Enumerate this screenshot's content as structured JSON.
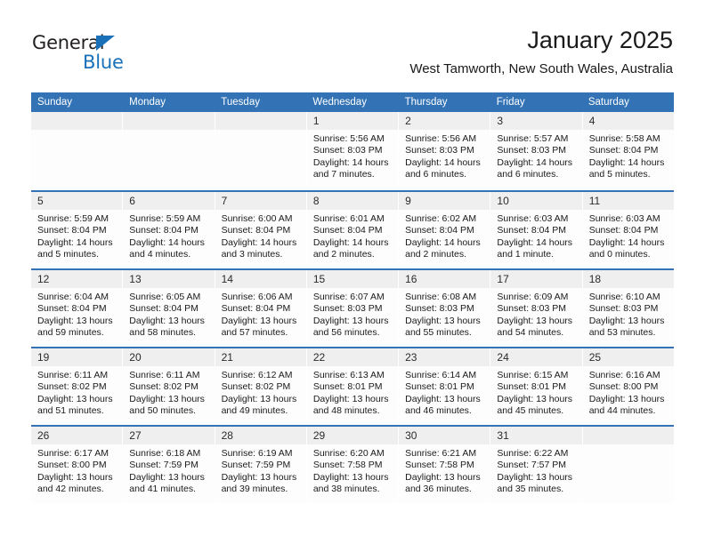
{
  "brand": {
    "name_top": "General",
    "name_bottom": "Blue",
    "accent_color": "#1a71b8"
  },
  "header": {
    "title": "January 2025",
    "subtitle": "West Tamworth, New South Wales, Australia"
  },
  "calendar": {
    "header_bg": "#3373b5",
    "daynum_bg": "#efefef",
    "weekdays": [
      "Sunday",
      "Monday",
      "Tuesday",
      "Wednesday",
      "Thursday",
      "Friday",
      "Saturday"
    ],
    "weeks": [
      [
        {
          "day": "",
          "lines": []
        },
        {
          "day": "",
          "lines": []
        },
        {
          "day": "",
          "lines": []
        },
        {
          "day": "1",
          "lines": [
            "Sunrise: 5:56 AM",
            "Sunset: 8:03 PM",
            "Daylight: 14 hours",
            "and 7 minutes."
          ]
        },
        {
          "day": "2",
          "lines": [
            "Sunrise: 5:56 AM",
            "Sunset: 8:03 PM",
            "Daylight: 14 hours",
            "and 6 minutes."
          ]
        },
        {
          "day": "3",
          "lines": [
            "Sunrise: 5:57 AM",
            "Sunset: 8:03 PM",
            "Daylight: 14 hours",
            "and 6 minutes."
          ]
        },
        {
          "day": "4",
          "lines": [
            "Sunrise: 5:58 AM",
            "Sunset: 8:04 PM",
            "Daylight: 14 hours",
            "and 5 minutes."
          ]
        }
      ],
      [
        {
          "day": "5",
          "lines": [
            "Sunrise: 5:59 AM",
            "Sunset: 8:04 PM",
            "Daylight: 14 hours",
            "and 5 minutes."
          ]
        },
        {
          "day": "6",
          "lines": [
            "Sunrise: 5:59 AM",
            "Sunset: 8:04 PM",
            "Daylight: 14 hours",
            "and 4 minutes."
          ]
        },
        {
          "day": "7",
          "lines": [
            "Sunrise: 6:00 AM",
            "Sunset: 8:04 PM",
            "Daylight: 14 hours",
            "and 3 minutes."
          ]
        },
        {
          "day": "8",
          "lines": [
            "Sunrise: 6:01 AM",
            "Sunset: 8:04 PM",
            "Daylight: 14 hours",
            "and 2 minutes."
          ]
        },
        {
          "day": "9",
          "lines": [
            "Sunrise: 6:02 AM",
            "Sunset: 8:04 PM",
            "Daylight: 14 hours",
            "and 2 minutes."
          ]
        },
        {
          "day": "10",
          "lines": [
            "Sunrise: 6:03 AM",
            "Sunset: 8:04 PM",
            "Daylight: 14 hours",
            "and 1 minute."
          ]
        },
        {
          "day": "11",
          "lines": [
            "Sunrise: 6:03 AM",
            "Sunset: 8:04 PM",
            "Daylight: 14 hours",
            "and 0 minutes."
          ]
        }
      ],
      [
        {
          "day": "12",
          "lines": [
            "Sunrise: 6:04 AM",
            "Sunset: 8:04 PM",
            "Daylight: 13 hours",
            "and 59 minutes."
          ]
        },
        {
          "day": "13",
          "lines": [
            "Sunrise: 6:05 AM",
            "Sunset: 8:04 PM",
            "Daylight: 13 hours",
            "and 58 minutes."
          ]
        },
        {
          "day": "14",
          "lines": [
            "Sunrise: 6:06 AM",
            "Sunset: 8:04 PM",
            "Daylight: 13 hours",
            "and 57 minutes."
          ]
        },
        {
          "day": "15",
          "lines": [
            "Sunrise: 6:07 AM",
            "Sunset: 8:03 PM",
            "Daylight: 13 hours",
            "and 56 minutes."
          ]
        },
        {
          "day": "16",
          "lines": [
            "Sunrise: 6:08 AM",
            "Sunset: 8:03 PM",
            "Daylight: 13 hours",
            "and 55 minutes."
          ]
        },
        {
          "day": "17",
          "lines": [
            "Sunrise: 6:09 AM",
            "Sunset: 8:03 PM",
            "Daylight: 13 hours",
            "and 54 minutes."
          ]
        },
        {
          "day": "18",
          "lines": [
            "Sunrise: 6:10 AM",
            "Sunset: 8:03 PM",
            "Daylight: 13 hours",
            "and 53 minutes."
          ]
        }
      ],
      [
        {
          "day": "19",
          "lines": [
            "Sunrise: 6:11 AM",
            "Sunset: 8:02 PM",
            "Daylight: 13 hours",
            "and 51 minutes."
          ]
        },
        {
          "day": "20",
          "lines": [
            "Sunrise: 6:11 AM",
            "Sunset: 8:02 PM",
            "Daylight: 13 hours",
            "and 50 minutes."
          ]
        },
        {
          "day": "21",
          "lines": [
            "Sunrise: 6:12 AM",
            "Sunset: 8:02 PM",
            "Daylight: 13 hours",
            "and 49 minutes."
          ]
        },
        {
          "day": "22",
          "lines": [
            "Sunrise: 6:13 AM",
            "Sunset: 8:01 PM",
            "Daylight: 13 hours",
            "and 48 minutes."
          ]
        },
        {
          "day": "23",
          "lines": [
            "Sunrise: 6:14 AM",
            "Sunset: 8:01 PM",
            "Daylight: 13 hours",
            "and 46 minutes."
          ]
        },
        {
          "day": "24",
          "lines": [
            "Sunrise: 6:15 AM",
            "Sunset: 8:01 PM",
            "Daylight: 13 hours",
            "and 45 minutes."
          ]
        },
        {
          "day": "25",
          "lines": [
            "Sunrise: 6:16 AM",
            "Sunset: 8:00 PM",
            "Daylight: 13 hours",
            "and 44 minutes."
          ]
        }
      ],
      [
        {
          "day": "26",
          "lines": [
            "Sunrise: 6:17 AM",
            "Sunset: 8:00 PM",
            "Daylight: 13 hours",
            "and 42 minutes."
          ]
        },
        {
          "day": "27",
          "lines": [
            "Sunrise: 6:18 AM",
            "Sunset: 7:59 PM",
            "Daylight: 13 hours",
            "and 41 minutes."
          ]
        },
        {
          "day": "28",
          "lines": [
            "Sunrise: 6:19 AM",
            "Sunset: 7:59 PM",
            "Daylight: 13 hours",
            "and 39 minutes."
          ]
        },
        {
          "day": "29",
          "lines": [
            "Sunrise: 6:20 AM",
            "Sunset: 7:58 PM",
            "Daylight: 13 hours",
            "and 38 minutes."
          ]
        },
        {
          "day": "30",
          "lines": [
            "Sunrise: 6:21 AM",
            "Sunset: 7:58 PM",
            "Daylight: 13 hours",
            "and 36 minutes."
          ]
        },
        {
          "day": "31",
          "lines": [
            "Sunrise: 6:22 AM",
            "Sunset: 7:57 PM",
            "Daylight: 13 hours",
            "and 35 minutes."
          ]
        },
        {
          "day": "",
          "lines": []
        }
      ]
    ]
  }
}
